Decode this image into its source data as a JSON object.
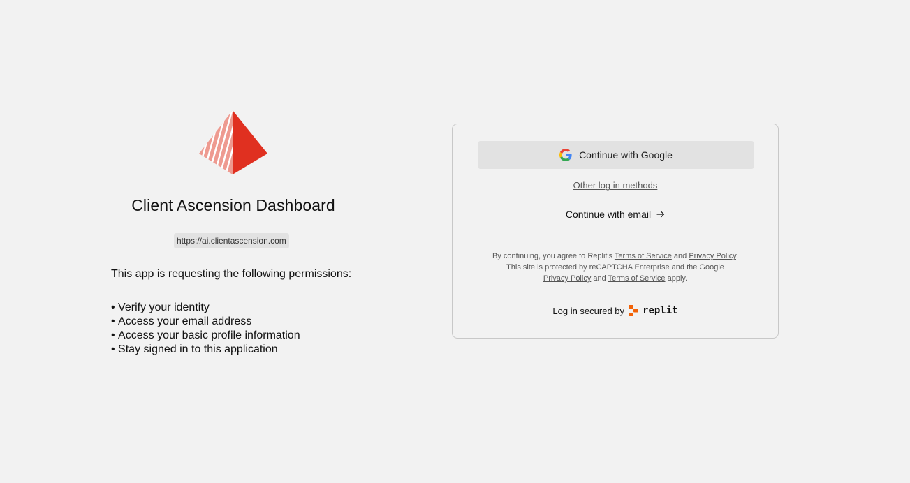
{
  "app": {
    "title": "Client Ascension Dashboard",
    "url": "https://ai.clientascension.com",
    "permissions_heading": "This app is requesting the following permissions:",
    "permissions": [
      "Verify your identity",
      "Access your email address",
      "Access your basic profile information",
      "Stay signed in to this application"
    ],
    "logo_icon": "pyramid-logo-icon",
    "logo_colors": {
      "light": "#ee9a90",
      "dark": "#e03020"
    }
  },
  "login": {
    "google_label": "Continue with Google",
    "other_methods_label": "Other log in methods",
    "email_label": "Continue with email",
    "legal": {
      "line1_prefix": "By continuing, you agree to Replit's ",
      "terms1": "Terms of Service",
      "and1": " and ",
      "privacy1": "Privacy Policy",
      "line1_suffix": ".",
      "line2": "This site is protected by reCAPTCHA Enterprise and the Google",
      "privacy2": "Privacy Policy",
      "and2": " and ",
      "terms2": "Terms of Service",
      "line3_suffix": " apply."
    },
    "secured_by": "Log in secured by",
    "brand": "replit",
    "brand_color": "#f26207"
  }
}
